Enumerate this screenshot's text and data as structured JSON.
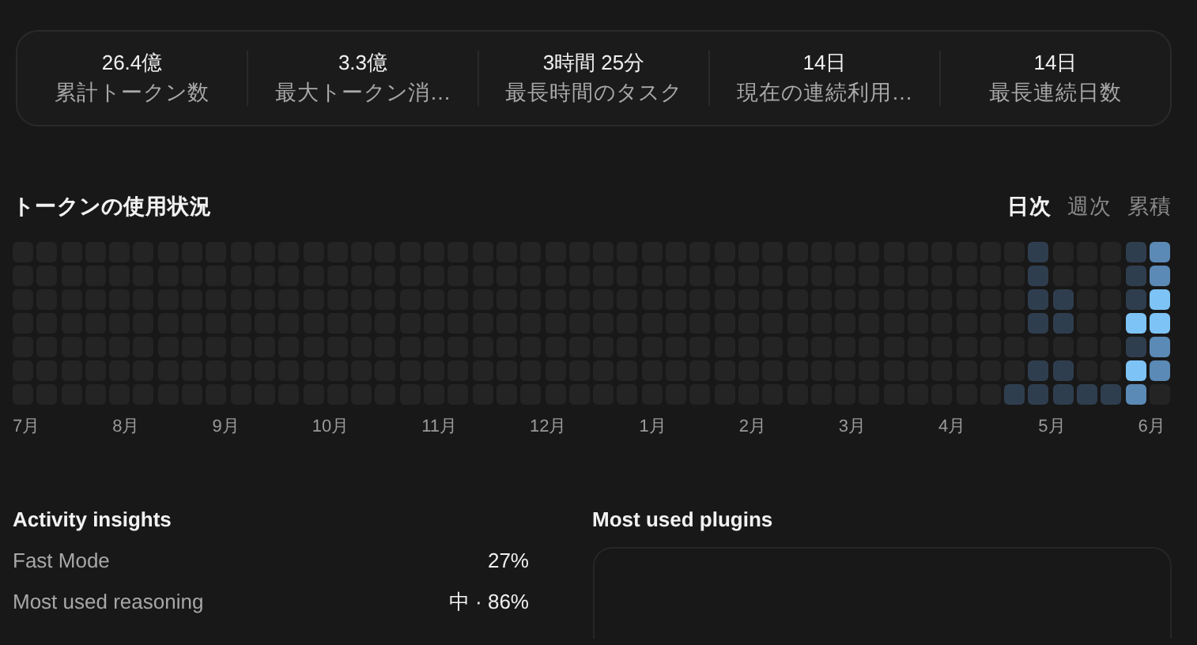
{
  "stats": [
    {
      "value": "26.4億",
      "label": "累計トークン数"
    },
    {
      "value": "3.3億",
      "label": "最大トークン消…"
    },
    {
      "value": "3時間 25分",
      "label": "最長時間のタスク"
    },
    {
      "value": "14日",
      "label": "現在の連続利用…"
    },
    {
      "value": "14日",
      "label": "最長連続日数"
    }
  ],
  "usage": {
    "title": "トークンの使用状況",
    "tabs": [
      {
        "label": "日次",
        "selected": true
      },
      {
        "label": "週次",
        "selected": false
      },
      {
        "label": "累積",
        "selected": false
      }
    ],
    "weeks": [
      [
        {
          "color": "#242424"
        },
        {
          "color": "#242424"
        },
        {
          "color": "#242424"
        },
        {
          "color": "#242424"
        },
        {
          "color": "#242424"
        },
        {
          "color": "#242424"
        },
        {
          "color": "#242424"
        }
      ],
      [
        {
          "color": "#242424"
        },
        {
          "color": "#242424"
        },
        {
          "color": "#242424"
        },
        {
          "color": "#242424"
        },
        {
          "color": "#242424"
        },
        {
          "color": "#242424"
        },
        {
          "color": "#242424"
        }
      ],
      [
        {
          "color": "#242424"
        },
        {
          "color": "#242424"
        },
        {
          "color": "#242424"
        },
        {
          "color": "#242424"
        },
        {
          "color": "#242424"
        },
        {
          "color": "#242424"
        },
        {
          "color": "#242424"
        }
      ],
      [
        {
          "color": "#242424"
        },
        {
          "color": "#242424"
        },
        {
          "color": "#242424"
        },
        {
          "color": "#242424"
        },
        {
          "color": "#242424"
        },
        {
          "color": "#242424"
        },
        {
          "color": "#242424"
        }
      ],
      [
        {
          "color": "#242424"
        },
        {
          "color": "#242424"
        },
        {
          "color": "#242424"
        },
        {
          "color": "#242424"
        },
        {
          "color": "#242424"
        },
        {
          "color": "#242424"
        },
        {
          "color": "#242424"
        }
      ],
      [
        {
          "color": "#242424"
        },
        {
          "color": "#242424"
        },
        {
          "color": "#242424"
        },
        {
          "color": "#242424"
        },
        {
          "color": "#242424"
        },
        {
          "color": "#242424"
        },
        {
          "color": "#242424"
        }
      ],
      [
        {
          "color": "#242424"
        },
        {
          "color": "#242424"
        },
        {
          "color": "#242424"
        },
        {
          "color": "#242424"
        },
        {
          "color": "#242424"
        },
        {
          "color": "#242424"
        },
        {
          "color": "#242424"
        }
      ],
      [
        {
          "color": "#242424"
        },
        {
          "color": "#242424"
        },
        {
          "color": "#242424"
        },
        {
          "color": "#242424"
        },
        {
          "color": "#242424"
        },
        {
          "color": "#242424"
        },
        {
          "color": "#242424"
        }
      ],
      [
        {
          "color": "#242424"
        },
        {
          "color": "#242424"
        },
        {
          "color": "#242424"
        },
        {
          "color": "#242424"
        },
        {
          "color": "#242424"
        },
        {
          "color": "#242424"
        },
        {
          "color": "#242424"
        }
      ],
      [
        {
          "color": "#242424"
        },
        {
          "color": "#242424"
        },
        {
          "color": "#242424"
        },
        {
          "color": "#242424"
        },
        {
          "color": "#242424"
        },
        {
          "color": "#242424"
        },
        {
          "color": "#242424"
        }
      ],
      [
        {
          "color": "#242424"
        },
        {
          "color": "#242424"
        },
        {
          "color": "#242424"
        },
        {
          "color": "#242424"
        },
        {
          "color": "#242424"
        },
        {
          "color": "#242424"
        },
        {
          "color": "#242424"
        }
      ],
      [
        {
          "color": "#242424"
        },
        {
          "color": "#242424"
        },
        {
          "color": "#242424"
        },
        {
          "color": "#242424"
        },
        {
          "color": "#242424"
        },
        {
          "color": "#242424"
        },
        {
          "color": "#242424"
        }
      ],
      [
        {
          "color": "#242424"
        },
        {
          "color": "#242424"
        },
        {
          "color": "#242424"
        },
        {
          "color": "#242424"
        },
        {
          "color": "#242424"
        },
        {
          "color": "#242424"
        },
        {
          "color": "#242424"
        }
      ],
      [
        {
          "color": "#242424"
        },
        {
          "color": "#242424"
        },
        {
          "color": "#242424"
        },
        {
          "color": "#242424"
        },
        {
          "color": "#242424"
        },
        {
          "color": "#242424"
        },
        {
          "color": "#242424"
        }
      ],
      [
        {
          "color": "#242424"
        },
        {
          "color": "#242424"
        },
        {
          "color": "#242424"
        },
        {
          "color": "#242424"
        },
        {
          "color": "#242424"
        },
        {
          "color": "#242424"
        },
        {
          "color": "#242424"
        }
      ],
      [
        {
          "color": "#242424"
        },
        {
          "color": "#242424"
        },
        {
          "color": "#242424"
        },
        {
          "color": "#242424"
        },
        {
          "color": "#242424"
        },
        {
          "color": "#242424"
        },
        {
          "color": "#242424"
        }
      ],
      [
        {
          "color": "#242424"
        },
        {
          "color": "#242424"
        },
        {
          "color": "#242424"
        },
        {
          "color": "#242424"
        },
        {
          "color": "#242424"
        },
        {
          "color": "#242424"
        },
        {
          "color": "#242424"
        }
      ],
      [
        {
          "color": "#242424"
        },
        {
          "color": "#242424"
        },
        {
          "color": "#242424"
        },
        {
          "color": "#242424"
        },
        {
          "color": "#242424"
        },
        {
          "color": "#242424"
        },
        {
          "color": "#242424"
        }
      ],
      [
        {
          "color": "#242424"
        },
        {
          "color": "#242424"
        },
        {
          "color": "#242424"
        },
        {
          "color": "#242424"
        },
        {
          "color": "#242424"
        },
        {
          "color": "#242424"
        },
        {
          "color": "#242424"
        }
      ],
      [
        {
          "color": "#242424"
        },
        {
          "color": "#242424"
        },
        {
          "color": "#242424"
        },
        {
          "color": "#242424"
        },
        {
          "color": "#242424"
        },
        {
          "color": "#242424"
        },
        {
          "color": "#242424"
        }
      ],
      [
        {
          "color": "#242424"
        },
        {
          "color": "#242424"
        },
        {
          "color": "#242424"
        },
        {
          "color": "#242424"
        },
        {
          "color": "#242424"
        },
        {
          "color": "#242424"
        },
        {
          "color": "#242424"
        }
      ],
      [
        {
          "color": "#242424"
        },
        {
          "color": "#242424"
        },
        {
          "color": "#242424"
        },
        {
          "color": "#242424"
        },
        {
          "color": "#242424"
        },
        {
          "color": "#242424"
        },
        {
          "color": "#242424"
        }
      ],
      [
        {
          "color": "#242424"
        },
        {
          "color": "#242424"
        },
        {
          "color": "#242424"
        },
        {
          "color": "#242424"
        },
        {
          "color": "#242424"
        },
        {
          "color": "#242424"
        },
        {
          "color": "#242424"
        }
      ],
      [
        {
          "color": "#242424"
        },
        {
          "color": "#242424"
        },
        {
          "color": "#242424"
        },
        {
          "color": "#242424"
        },
        {
          "color": "#242424"
        },
        {
          "color": "#242424"
        },
        {
          "color": "#242424"
        }
      ],
      [
        {
          "color": "#242424"
        },
        {
          "color": "#242424"
        },
        {
          "color": "#242424"
        },
        {
          "color": "#242424"
        },
        {
          "color": "#242424"
        },
        {
          "color": "#242424"
        },
        {
          "color": "#242424"
        }
      ],
      [
        {
          "color": "#242424"
        },
        {
          "color": "#242424"
        },
        {
          "color": "#242424"
        },
        {
          "color": "#242424"
        },
        {
          "color": "#242424"
        },
        {
          "color": "#242424"
        },
        {
          "color": "#242424"
        }
      ],
      [
        {
          "color": "#242424"
        },
        {
          "color": "#242424"
        },
        {
          "color": "#242424"
        },
        {
          "color": "#242424"
        },
        {
          "color": "#242424"
        },
        {
          "color": "#242424"
        },
        {
          "color": "#242424"
        }
      ],
      [
        {
          "color": "#242424"
        },
        {
          "color": "#242424"
        },
        {
          "color": "#242424"
        },
        {
          "color": "#242424"
        },
        {
          "color": "#242424"
        },
        {
          "color": "#242424"
        },
        {
          "color": "#242424"
        }
      ],
      [
        {
          "color": "#242424"
        },
        {
          "color": "#242424"
        },
        {
          "color": "#242424"
        },
        {
          "color": "#242424"
        },
        {
          "color": "#242424"
        },
        {
          "color": "#242424"
        },
        {
          "color": "#242424"
        }
      ],
      [
        {
          "color": "#242424"
        },
        {
          "color": "#242424"
        },
        {
          "color": "#242424"
        },
        {
          "color": "#242424"
        },
        {
          "color": "#242424"
        },
        {
          "color": "#242424"
        },
        {
          "color": "#242424"
        }
      ],
      [
        {
          "color": "#242424"
        },
        {
          "color": "#242424"
        },
        {
          "color": "#242424"
        },
        {
          "color": "#242424"
        },
        {
          "color": "#242424"
        },
        {
          "color": "#242424"
        },
        {
          "color": "#242424"
        }
      ],
      [
        {
          "color": "#242424"
        },
        {
          "color": "#242424"
        },
        {
          "color": "#242424"
        },
        {
          "color": "#242424"
        },
        {
          "color": "#242424"
        },
        {
          "color": "#242424"
        },
        {
          "color": "#242424"
        }
      ],
      [
        {
          "color": "#242424"
        },
        {
          "color": "#242424"
        },
        {
          "color": "#242424"
        },
        {
          "color": "#242424"
        },
        {
          "color": "#242424"
        },
        {
          "color": "#242424"
        },
        {
          "color": "#242424"
        }
      ],
      [
        {
          "color": "#242424"
        },
        {
          "color": "#242424"
        },
        {
          "color": "#242424"
        },
        {
          "color": "#242424"
        },
        {
          "color": "#242424"
        },
        {
          "color": "#242424"
        },
        {
          "color": "#242424"
        }
      ],
      [
        {
          "color": "#242424"
        },
        {
          "color": "#242424"
        },
        {
          "color": "#242424"
        },
        {
          "color": "#242424"
        },
        {
          "color": "#242424"
        },
        {
          "color": "#242424"
        },
        {
          "color": "#242424"
        }
      ],
      [
        {
          "color": "#242424"
        },
        {
          "color": "#242424"
        },
        {
          "color": "#242424"
        },
        {
          "color": "#242424"
        },
        {
          "color": "#242424"
        },
        {
          "color": "#242424"
        },
        {
          "color": "#242424"
        }
      ],
      [
        {
          "color": "#242424"
        },
        {
          "color": "#242424"
        },
        {
          "color": "#242424"
        },
        {
          "color": "#242424"
        },
        {
          "color": "#242424"
        },
        {
          "color": "#242424"
        },
        {
          "color": "#242424"
        }
      ],
      [
        {
          "color": "#242424"
        },
        {
          "color": "#242424"
        },
        {
          "color": "#242424"
        },
        {
          "color": "#242424"
        },
        {
          "color": "#242424"
        },
        {
          "color": "#242424"
        },
        {
          "color": "#242424"
        }
      ],
      [
        {
          "color": "#242424"
        },
        {
          "color": "#242424"
        },
        {
          "color": "#242424"
        },
        {
          "color": "#242424"
        },
        {
          "color": "#242424"
        },
        {
          "color": "#242424"
        },
        {
          "color": "#242424"
        }
      ],
      [
        {
          "color": "#242424"
        },
        {
          "color": "#242424"
        },
        {
          "color": "#242424"
        },
        {
          "color": "#242424"
        },
        {
          "color": "#242424"
        },
        {
          "color": "#242424"
        },
        {
          "color": "#242424"
        }
      ],
      [
        {
          "color": "#242424"
        },
        {
          "color": "#242424"
        },
        {
          "color": "#242424"
        },
        {
          "color": "#242424"
        },
        {
          "color": "#242424"
        },
        {
          "color": "#242424"
        },
        {
          "color": "#242424"
        }
      ],
      [
        {
          "color": "#242424"
        },
        {
          "color": "#242424"
        },
        {
          "color": "#242424"
        },
        {
          "color": "#242424"
        },
        {
          "color": "#242424"
        },
        {
          "color": "#242424"
        },
        {
          "color": "#2f3e4f"
        }
      ],
      [
        {
          "color": "#2f3e4f"
        },
        {
          "color": "#2f3e4f"
        },
        {
          "color": "#2f3e4f"
        },
        {
          "color": "#2f3e4f"
        },
        {
          "color": "#242424"
        },
        {
          "color": "#2f3e4f"
        },
        {
          "color": "#2f3e4f"
        }
      ],
      [
        {
          "color": "#242424"
        },
        {
          "color": "#242424"
        },
        {
          "color": "#2f3e4f"
        },
        {
          "color": "#2f3e4f"
        },
        {
          "color": "#242424"
        },
        {
          "color": "#2f3e4f"
        },
        {
          "color": "#2f3e4f"
        }
      ],
      [
        {
          "color": "#242424"
        },
        {
          "color": "#242424"
        },
        {
          "color": "#242424"
        },
        {
          "color": "#242424"
        },
        {
          "color": "#242424"
        },
        {
          "color": "#242424"
        },
        {
          "color": "#2f3e4f"
        }
      ],
      [
        {
          "color": "#242424"
        },
        {
          "color": "#242424"
        },
        {
          "color": "#242424"
        },
        {
          "color": "#242424"
        },
        {
          "color": "#242424"
        },
        {
          "color": "#242424"
        },
        {
          "color": "#2f3e4f"
        }
      ],
      [
        {
          "color": "#2f3e4f"
        },
        {
          "color": "#2f3e4f"
        },
        {
          "color": "#2f3e4f"
        },
        {
          "color": "#7ec3f5"
        },
        {
          "color": "#2f3e4f"
        },
        {
          "color": "#7ec3f5"
        },
        {
          "color": "#5a8ab5"
        }
      ],
      [
        {
          "color": "#5a8ab5"
        },
        {
          "color": "#5a8ab5"
        },
        {
          "color": "#7ec3f5"
        },
        {
          "color": "#7ec3f5"
        },
        {
          "color": "#5a8ab5"
        },
        {
          "color": "#5a8ab5"
        },
        {
          "color": "#242424"
        }
      ]
    ],
    "months": [
      "7月",
      "8月",
      "9月",
      "10月",
      "11月",
      "12月",
      "1月",
      "2月",
      "3月",
      "4月",
      "5月",
      "6月"
    ]
  },
  "insights": {
    "title": "Activity insights",
    "rows": [
      {
        "label": "Fast Mode",
        "value": "27%"
      },
      {
        "label": "Most used reasoning",
        "value": "中 · 86%"
      }
    ]
  },
  "plugins": {
    "title": "Most used plugins"
  }
}
